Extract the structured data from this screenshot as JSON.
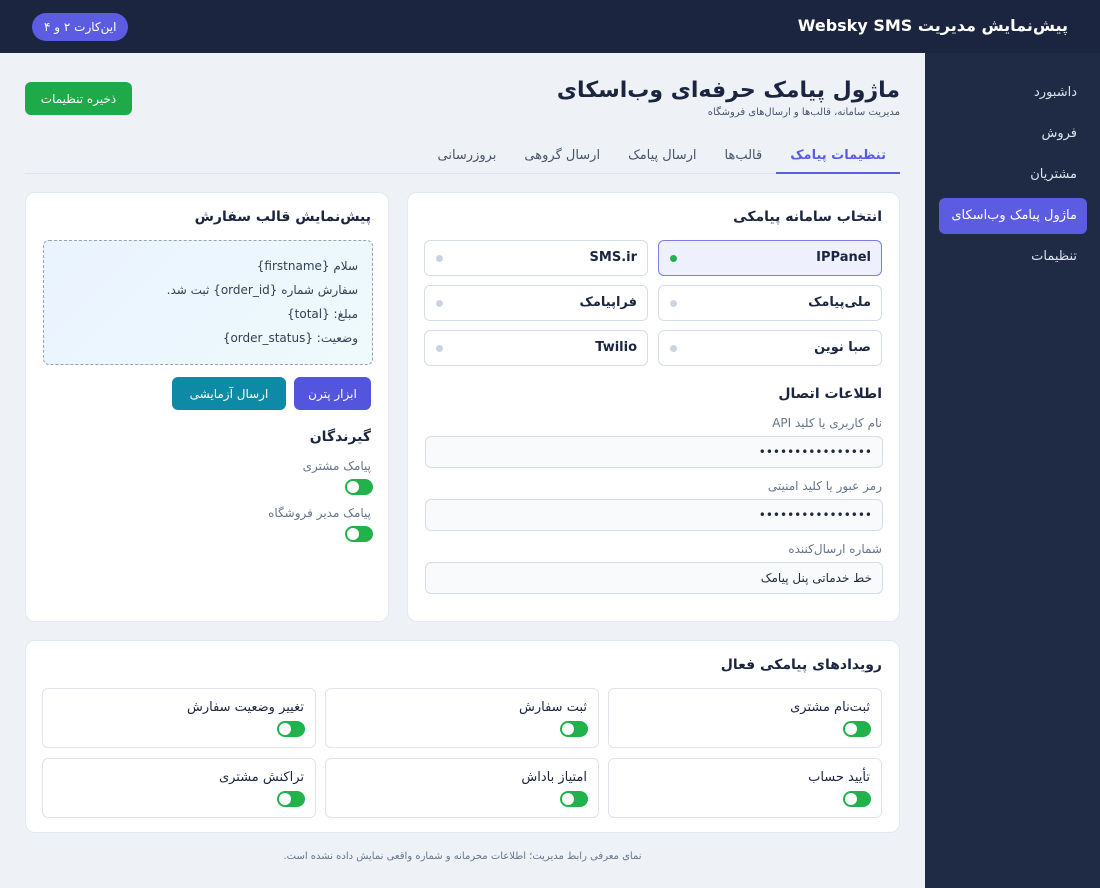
{
  "topbar": {
    "title": "پیش‌نمایش مدیریت Websky SMS",
    "badge": "این‌کارت ۲ و ۴"
  },
  "sidebar": {
    "items": [
      {
        "label": "داشبورد",
        "active": false
      },
      {
        "label": "فروش",
        "active": false
      },
      {
        "label": "مشتریان",
        "active": false
      },
      {
        "label": "ماژول پیامک وب‌اسکای",
        "active": true
      },
      {
        "label": "تنظیمات",
        "active": false
      }
    ]
  },
  "header": {
    "title": "ماژول پیامک حرفه‌ای وب‌اسکای",
    "subtitle": "مدیریت سامانه، قالب‌ها و ارسال‌های فروشگاه",
    "save_label": "ذخیره تنظیمات"
  },
  "tabs": [
    {
      "label": "تنظیمات پیامک",
      "active": true
    },
    {
      "label": "قالب‌ها",
      "active": false
    },
    {
      "label": "ارسال پیامک",
      "active": false
    },
    {
      "label": "ارسال گروهی",
      "active": false
    },
    {
      "label": "بروزرسانی",
      "active": false
    }
  ],
  "providers": {
    "title": "انتخاب سامانه پیامکی",
    "items": [
      {
        "name": "IPPanel",
        "selected": true
      },
      {
        "name": "SMS.ir",
        "selected": false
      },
      {
        "name": "ملی‌پیامک",
        "selected": false
      },
      {
        "name": "فراپیامک",
        "selected": false
      },
      {
        "name": "صبا نوین",
        "selected": false
      },
      {
        "name": "Twilio",
        "selected": false
      }
    ]
  },
  "connection": {
    "title": "اطلاعات اتصال",
    "username_label": "نام کاربری یا کلید API",
    "username_value": "••••••••••••••••",
    "password_label": "رمز عبور یا کلید امنیتی",
    "password_value": "••••••••••••••••",
    "sender_label": "شماره ارسال‌کننده",
    "sender_value": "خط خدماتی پنل پیامک"
  },
  "preview": {
    "title": "پیش‌نمایش قالب سفارش",
    "lines": [
      "سلام {firstname}",
      "سفارش شماره {order_id} ثبت شد.",
      "مبلغ: {total}",
      "وضعیت: {order_status}"
    ],
    "pattern_button": "ابزار پترن",
    "test_button": "ارسال آزمایشی"
  },
  "recipients": {
    "title": "گیرندگان",
    "customer_label": "پیامک مشتری",
    "customer_enabled": true,
    "admin_label": "پیامک مدیر فروشگاه",
    "admin_enabled": true
  },
  "events": {
    "title": "رویدادهای پیامکی فعال",
    "items": [
      {
        "label": "ثبت‌نام مشتری",
        "enabled": true
      },
      {
        "label": "ثبت سفارش",
        "enabled": true
      },
      {
        "label": "تغییر وضعیت سفارش",
        "enabled": true
      },
      {
        "label": "تأیید حساب",
        "enabled": true
      },
      {
        "label": "امتیاز باداش",
        "enabled": true
      },
      {
        "label": "تراکنش مشتری",
        "enabled": true
      }
    ]
  },
  "footer": {
    "note": "نمای معرفی رابط مدیریت؛ اطلاعات محرمانه و شماره واقعی نمایش داده نشده است."
  },
  "colors": {
    "topbar": "#1b2540",
    "sidebar": "#1f2a45",
    "accent": "#5b5ce2",
    "success": "#1faa4a",
    "teal": "#0e8aa6"
  }
}
